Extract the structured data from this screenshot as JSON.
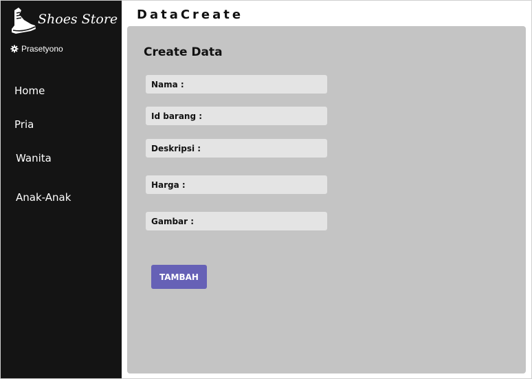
{
  "app": {
    "brand": "Shoes Store",
    "user_name": "Prasetyono"
  },
  "sidebar": {
    "items": [
      {
        "label": "Home"
      },
      {
        "label": "Pria"
      },
      {
        "label": "Wanita"
      },
      {
        "label": "Anak-Anak"
      }
    ]
  },
  "header": {
    "title": "DataCreate"
  },
  "form": {
    "title": "Create Data",
    "fields": [
      {
        "label": "Nama :",
        "value": ""
      },
      {
        "label": "Id barang :",
        "value": ""
      },
      {
        "label": "Deskripsi :",
        "value": ""
      },
      {
        "label": "Harga :",
        "value": ""
      },
      {
        "label": "Gambar :",
        "value": ""
      }
    ],
    "submit_label": "TAMBAH"
  },
  "colors": {
    "sidebar_bg": "#141414",
    "panel_bg": "#c4c4c4",
    "field_bg": "#e4e4e4",
    "button_bg": "#6661b6"
  },
  "icons": {
    "logo": "shoe-icon",
    "user": "gear-icon"
  }
}
